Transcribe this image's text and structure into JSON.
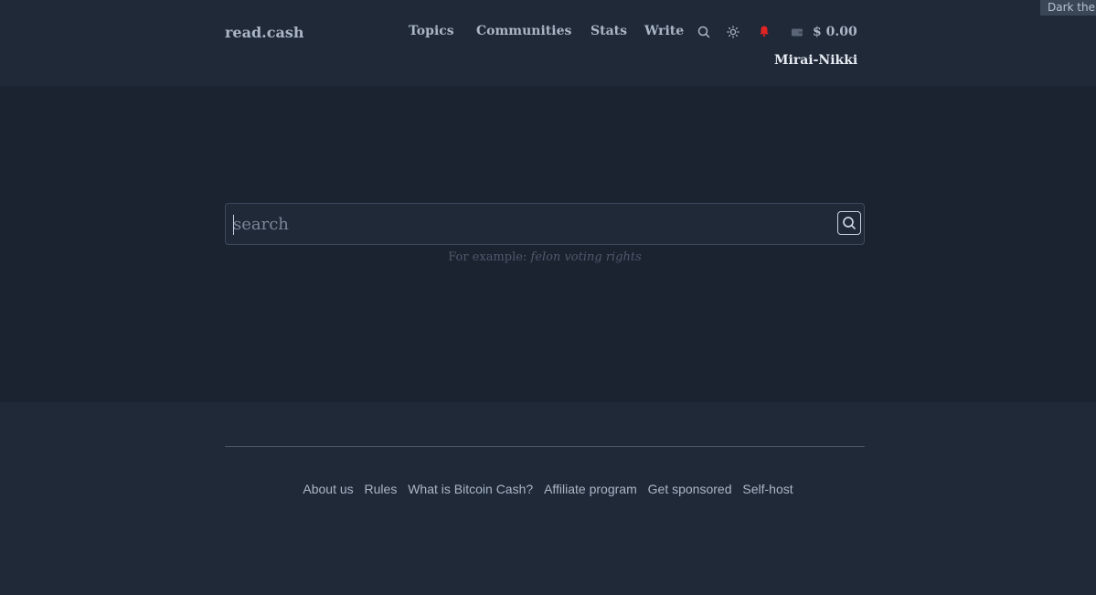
{
  "header": {
    "logo": "read.cash",
    "nav": {
      "topics": "Topics",
      "communities": "Communities",
      "stats": "Stats",
      "write": "Write"
    },
    "balance": "$ 0.00",
    "username": "Mirai-Nikki",
    "theme_tooltip": "Dark theme",
    "icons": [
      "search-icon",
      "sun-icon",
      "bell-icon",
      "wallet-icon"
    ]
  },
  "search": {
    "placeholder": "search",
    "example_prefix": "For example:",
    "example_query": "felon voting rights"
  },
  "footer": {
    "links": [
      "About us",
      "Rules",
      "What is Bitcoin Cash?",
      "Affiliate program",
      "Get sponsored",
      "Self-host"
    ]
  },
  "colors": {
    "header_bg": "#202938",
    "main_bg": "#1b2230",
    "text": "#aab6c6",
    "notification": "#e02424"
  }
}
